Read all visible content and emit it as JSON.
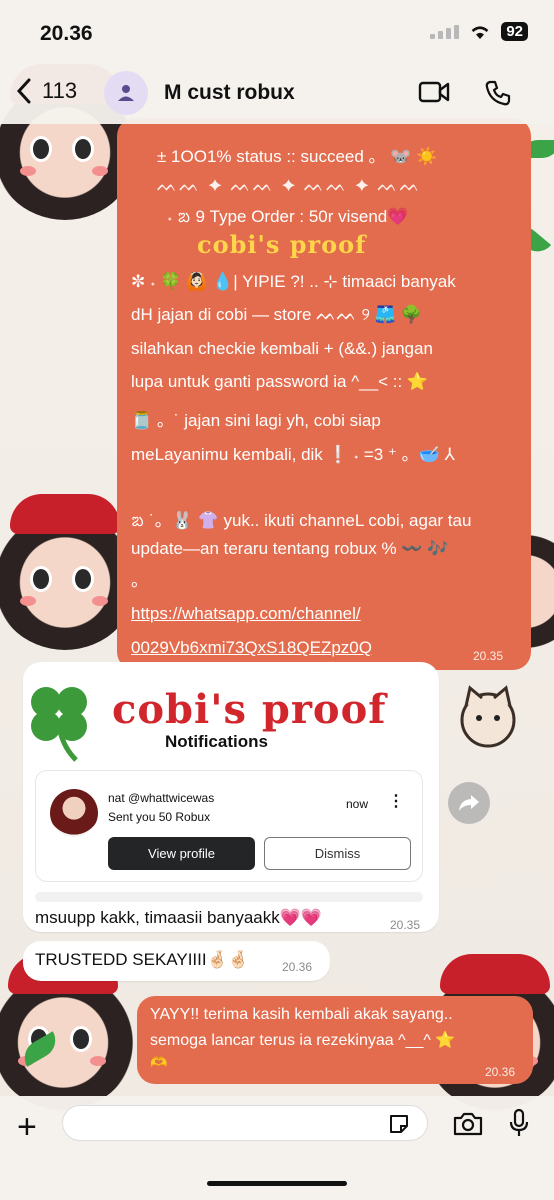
{
  "status_bar": {
    "time": "20.36",
    "battery": "92"
  },
  "header": {
    "back_count": "113",
    "chat_title": "M cust robux"
  },
  "outgoing_message_1": {
    "lines": [
      "± 1OO1% status :: succeed  。  🐭 ☀️",
      "ᨓᨓ   ✦   ᨓᨓ   ✦   ᨓᨓ   ✦   ᨓᨓ",
      "  ˖ ᨰ 9 Type Order : 50r visend💗",
      "✼ ˖ 🍀 🙆🏻 💧| YIPIE ?!  ..  ⊹ timaaci banyak",
      "dH jajan di cobi — store  ᨓᨓ ୨  🩳 🌳",
      "silahkan checkie kembali  +  (&&.) jangan",
      "lupa untuk ganti password ia ^__<  ::  ⭐",
      "🫙  。˙ jajan sini lagi yh, cobi siap",
      "meLayanimu kembali, dik  ❕ ˖ =3 ⁺  。🥣  ⅄",
      "ᨰ ˙。🐰 👚  yuk.. ikuti channeL cobi, agar tau",
      "update—an teraru tentang robux %  〰️  🎶",
      "  。"
    ],
    "link_lines": [
      "https://whatsapp.com/channel/",
      "0029Vb6xmi73QxS18QEZpz0Q"
    ],
    "time": "20.35",
    "proof_title": "cobi's proof"
  },
  "image_message": {
    "proof_title": "cobi's proof",
    "notifications_heading": "Notifications",
    "notification": {
      "name": "nat @whattwicewas",
      "text": "Sent you 50 Robux",
      "time": "now",
      "more": "⋮",
      "view_label": "View profile",
      "dismiss_label": "Dismiss"
    },
    "caption": "msuupp kakk, timaasii banyaakk💗💗",
    "time": "20.35"
  },
  "incoming_message_2": {
    "text": "TRUSTEDD SEKAYIIII🤞🏻🤞🏻",
    "time": "20.36"
  },
  "outgoing_message_2": {
    "lines": [
      "YAYY!! terima kasih kembali akak sayang..",
      "semoga lancar terus ia rezekinyaa ^__^ ⭐",
      "🫶"
    ],
    "time": "20.36"
  },
  "colors": {
    "outgoing_bubble": "#e46c4e",
    "incoming_bubble": "#ffffff",
    "accent": "#c8202a"
  }
}
